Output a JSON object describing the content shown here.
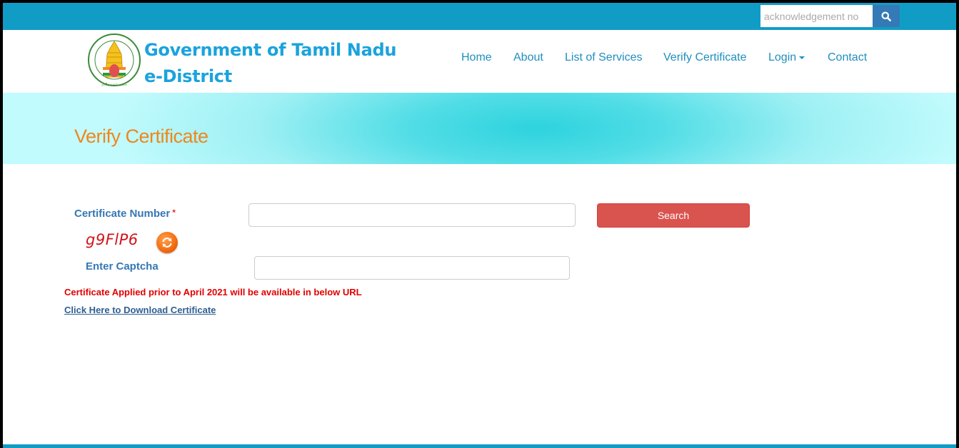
{
  "topbar": {
    "acknowledgement_placeholder": "acknowledgement no",
    "search_icon": "search-icon"
  },
  "header": {
    "brand_line1": "Government of Tamil Nadu",
    "brand_line2": "e-District",
    "logo": "tamil-nadu-emblem"
  },
  "nav": {
    "items": [
      {
        "label": "Home"
      },
      {
        "label": "About"
      },
      {
        "label": "List of Services"
      },
      {
        "label": "Verify Certificate"
      },
      {
        "label": "Login",
        "has_dropdown": true
      },
      {
        "label": "Contact"
      }
    ]
  },
  "banner": {
    "title": "Verify Certificate"
  },
  "form": {
    "certificate_number_label": "Certificate Number",
    "required_marker": "*",
    "certificate_number_value": "",
    "search_button": "Search",
    "captcha_text": "g9FlP6",
    "refresh_icon": "refresh-icon",
    "enter_captcha_label": "Enter Captcha",
    "captcha_value": "",
    "notice": "Certificate Applied prior to April 2021 will be available in below URL",
    "download_link": "Click Here to Download Certificate"
  },
  "colors": {
    "topbar": "#119cc6",
    "brand": "#1aa3dd",
    "nav_link": "#1f8fbf",
    "banner_title": "#f0861c",
    "label": "#3577b5",
    "search_button": "#d9534f",
    "notice": "#e10000",
    "captcha": "#d0141a"
  }
}
